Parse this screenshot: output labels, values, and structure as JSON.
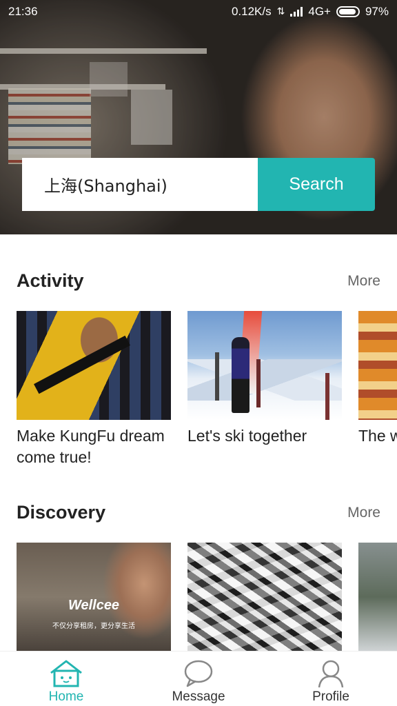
{
  "status_bar": {
    "time": "21:36",
    "network_speed": "0.12K/s",
    "network_type": "4G+",
    "battery": "97%",
    "icons": [
      "data-transfer-icon",
      "signal-icon",
      "battery-icon"
    ]
  },
  "search": {
    "value": "上海(Shanghai)",
    "button_label": "Search"
  },
  "activity": {
    "title": "Activity",
    "more_label": "More",
    "cards": [
      {
        "caption": "Make KungFu dream come true!"
      },
      {
        "caption": "Let's ski together"
      },
      {
        "caption": "The we"
      }
    ]
  },
  "discovery": {
    "title": "Discovery",
    "more_label": "More",
    "cards": [
      {
        "logo_text": "Wellcee",
        "logo_subtitle": "不仅分享租房，更分享生活"
      },
      {},
      {}
    ]
  },
  "tabbar": {
    "tabs": [
      {
        "label": "Home",
        "icon": "home-icon",
        "active": true
      },
      {
        "label": "Message",
        "icon": "message-icon",
        "active": false
      },
      {
        "label": "Profile",
        "icon": "profile-icon",
        "active": false
      }
    ]
  },
  "colors": {
    "accent": "#22b5b1"
  }
}
